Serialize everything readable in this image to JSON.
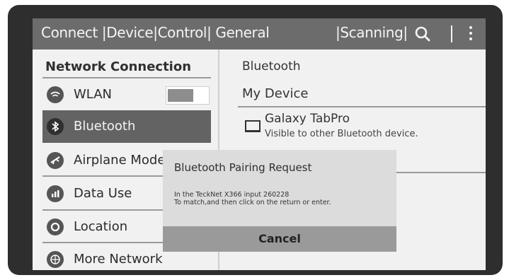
{
  "topbar": {
    "tab_connect": "Connect",
    "tab_device": "Device",
    "tab_control": "Control",
    "tab_general": "General",
    "separator": "|",
    "scanning": "Scanning",
    "search_icon": "search-icon",
    "more_icon": "more-vertical-icon"
  },
  "sidebar": {
    "section_title": "Network Connection",
    "items": [
      {
        "label": "WLAN",
        "icon": "wifi-icon"
      },
      {
        "label": "Bluetooth",
        "icon": "bluetooth-icon",
        "active": true
      },
      {
        "label": "Airplane Mode",
        "icon": "airplane-icon"
      },
      {
        "label": "Data Use",
        "icon": "data-usage-icon"
      },
      {
        "label": "Location",
        "icon": "location-icon"
      },
      {
        "label": "More Network",
        "icon": "more-network-icon"
      }
    ],
    "wlan_toggle_state": "off"
  },
  "content": {
    "title": "Bluetooth",
    "section": "My Device",
    "device_name": "Galaxy TabPro",
    "device_status": "Visible to other Bluetooth device."
  },
  "dialog": {
    "title": "Bluetooth Pairing Request",
    "line1": "In the TeckNet X366 input 260228",
    "line2": "To match,and then click on the return or enter.",
    "cancel_label": "Cancel"
  },
  "colors": {
    "bezel": "#2e2e2e",
    "topbar": "#6c6c6c",
    "active_item": "#636363",
    "dialog": "#dcdcdc",
    "cancel_button": "#9a9a9a"
  }
}
